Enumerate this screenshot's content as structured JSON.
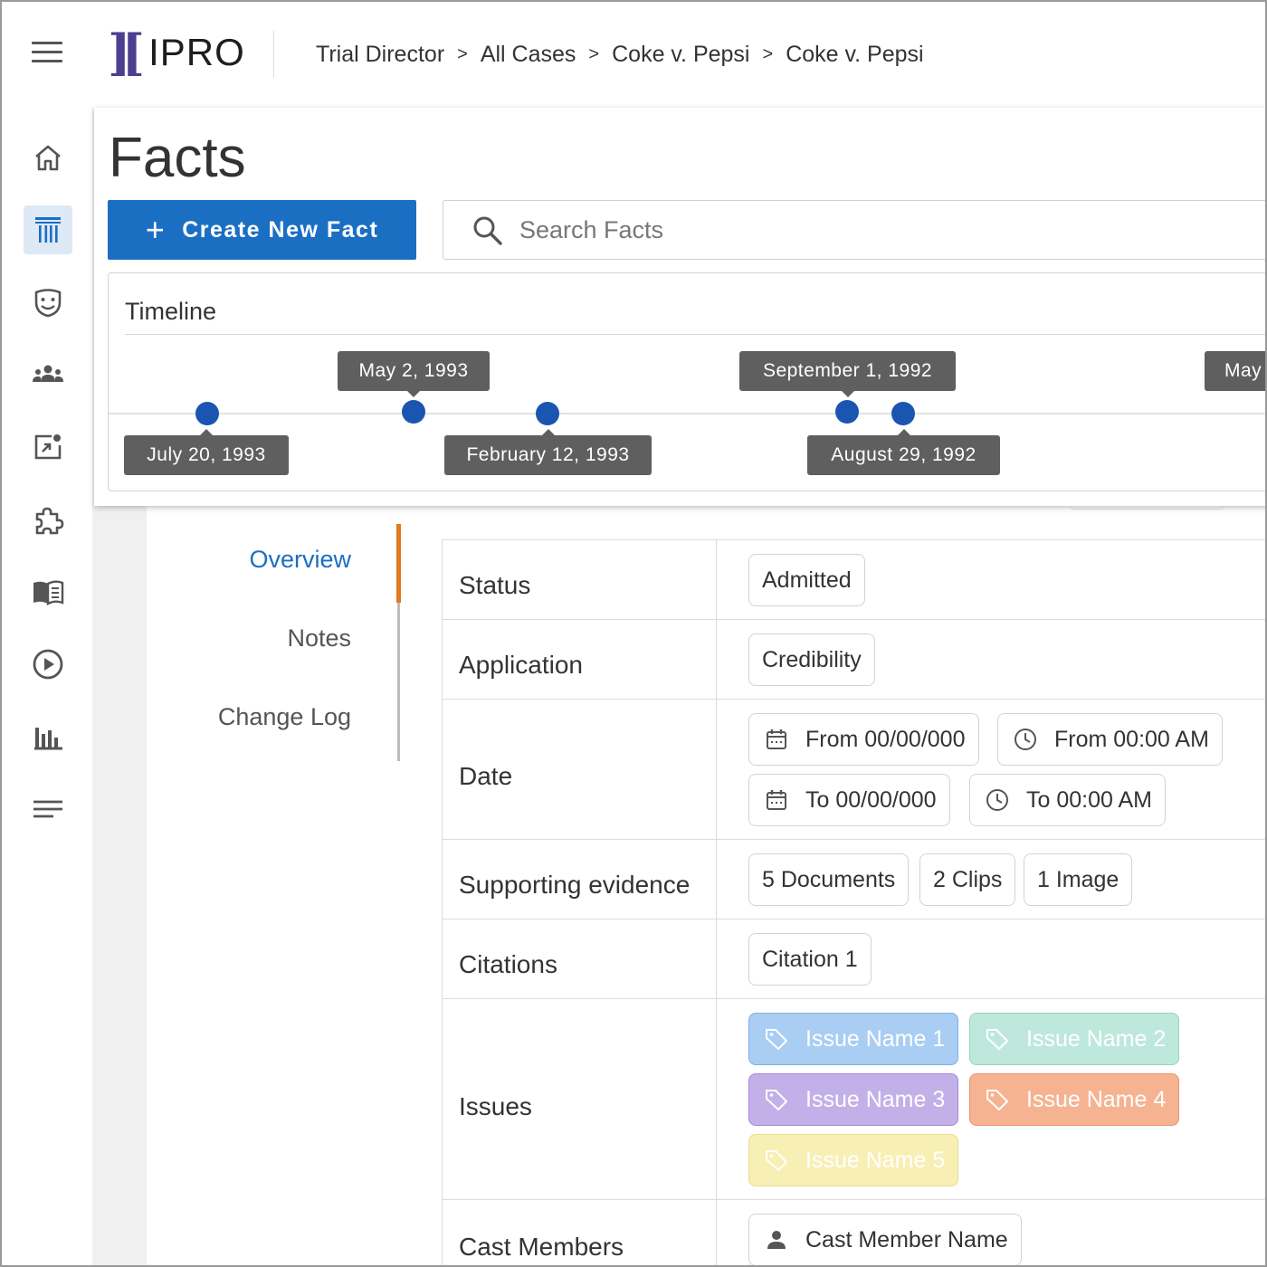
{
  "header": {
    "logo_text": "IPRO",
    "breadcrumbs": [
      "Trial Director",
      "All Cases",
      "Coke v. Pepsi",
      "Coke v. Pepsi"
    ],
    "separator": ">"
  },
  "nav": {
    "items": [
      {
        "icon": "home-icon"
      },
      {
        "icon": "courthouse-icon",
        "active": true
      },
      {
        "icon": "drama-masks-icon"
      },
      {
        "icon": "people-icon"
      },
      {
        "icon": "presentation-icon"
      },
      {
        "icon": "puzzle-icon"
      },
      {
        "icon": "book-icon"
      },
      {
        "icon": "play-circle-icon"
      },
      {
        "icon": "bar-chart-icon"
      },
      {
        "icon": "text-lines-icon"
      }
    ]
  },
  "page": {
    "title": "Facts",
    "create_button": "Create New Fact",
    "search_placeholder": "Search Facts"
  },
  "timeline": {
    "title": "Timeline",
    "labels": [
      "July 20, 1993",
      "May 2, 1993",
      "February 12, 1993",
      "September 1, 1992",
      "August 29, 1992",
      "May"
    ]
  },
  "subnav": {
    "items": [
      "Overview",
      "Notes",
      "Change Log"
    ],
    "active": "Overview"
  },
  "details": {
    "status": {
      "label": "Status",
      "value": "Admitted"
    },
    "application": {
      "label": "Application",
      "value": "Credibility"
    },
    "date": {
      "label": "Date",
      "from_date": "From 00/00/000",
      "from_time": "From 00:00 AM",
      "to_date": "To 00/00/000",
      "to_time": "To 00:00 AM"
    },
    "evidence": {
      "label": "Supporting evidence",
      "values": [
        "5 Documents",
        "2 Clips",
        "1 Image"
      ]
    },
    "citations": {
      "label": "Citations",
      "values": [
        "Citation 1"
      ]
    },
    "issues": {
      "label": "Issues",
      "values": [
        {
          "name": "Issue Name 1",
          "bg": "#a9cdf3",
          "border": "#7fb0e6"
        },
        {
          "name": "Issue Name 2",
          "bg": "#bfe8dc",
          "border": "#97d3c1"
        },
        {
          "name": "Issue Name 3",
          "bg": "#c3b0e8",
          "border": "#a48ad7"
        },
        {
          "name": "Issue Name 4",
          "bg": "#f5b392",
          "border": "#e49570"
        },
        {
          "name": "Issue Name 5",
          "bg": "#f8efb4",
          "border": "#e8dc8c"
        }
      ]
    },
    "cast": {
      "label": "Cast Members",
      "values": [
        "Cast Member Name"
      ]
    }
  },
  "colors": {
    "primary": "#1b6fc2",
    "accent": "#e07b1f",
    "timeline_dot": "#1a55b0",
    "tooltip": "#5f5f5f"
  }
}
